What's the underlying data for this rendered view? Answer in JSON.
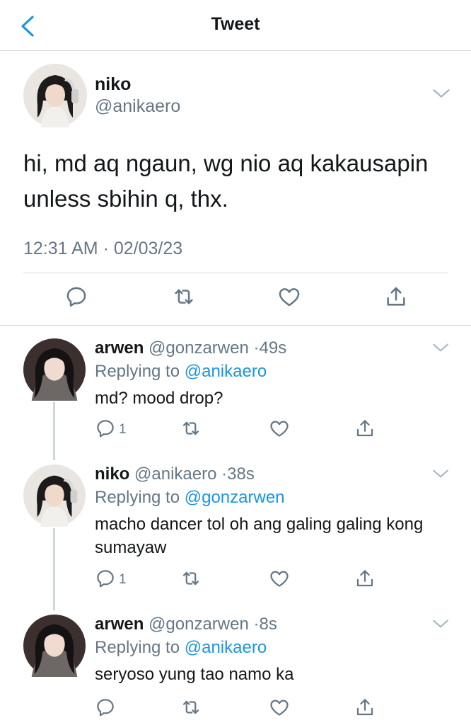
{
  "header": {
    "title": "Tweet",
    "back_icon": "chevron-left-icon",
    "accent_color": "#1b95e0"
  },
  "main_tweet": {
    "name": "niko",
    "handle": "@anikaero",
    "text": "hi, md aq ngaun, wg nio aq kakausapin unless sbihin q, thx.",
    "timestamp": "12:31 AM · 02/03/23",
    "actions": [
      "reply-icon",
      "retweet-icon",
      "like-icon",
      "share-icon"
    ]
  },
  "replies": [
    {
      "name": "arwen",
      "handle": "@gonzarwen",
      "time": "49s",
      "replying_label": "Replying to",
      "replying_to": "@anikaero",
      "text": "md? mood drop?",
      "reply_count": "1"
    },
    {
      "name": "niko",
      "handle": "@anikaero",
      "time": "38s",
      "replying_label": "Replying to",
      "replying_to": "@gonzarwen",
      "text": "macho dancer tol oh ang galing galing kong sumayaw",
      "reply_count": "1"
    },
    {
      "name": "arwen",
      "handle": "@gonzarwen",
      "time": "8s",
      "replying_label": "Replying to",
      "replying_to": "@anikaero",
      "text": "seryoso yung tao namo ka",
      "reply_count": ""
    }
  ]
}
